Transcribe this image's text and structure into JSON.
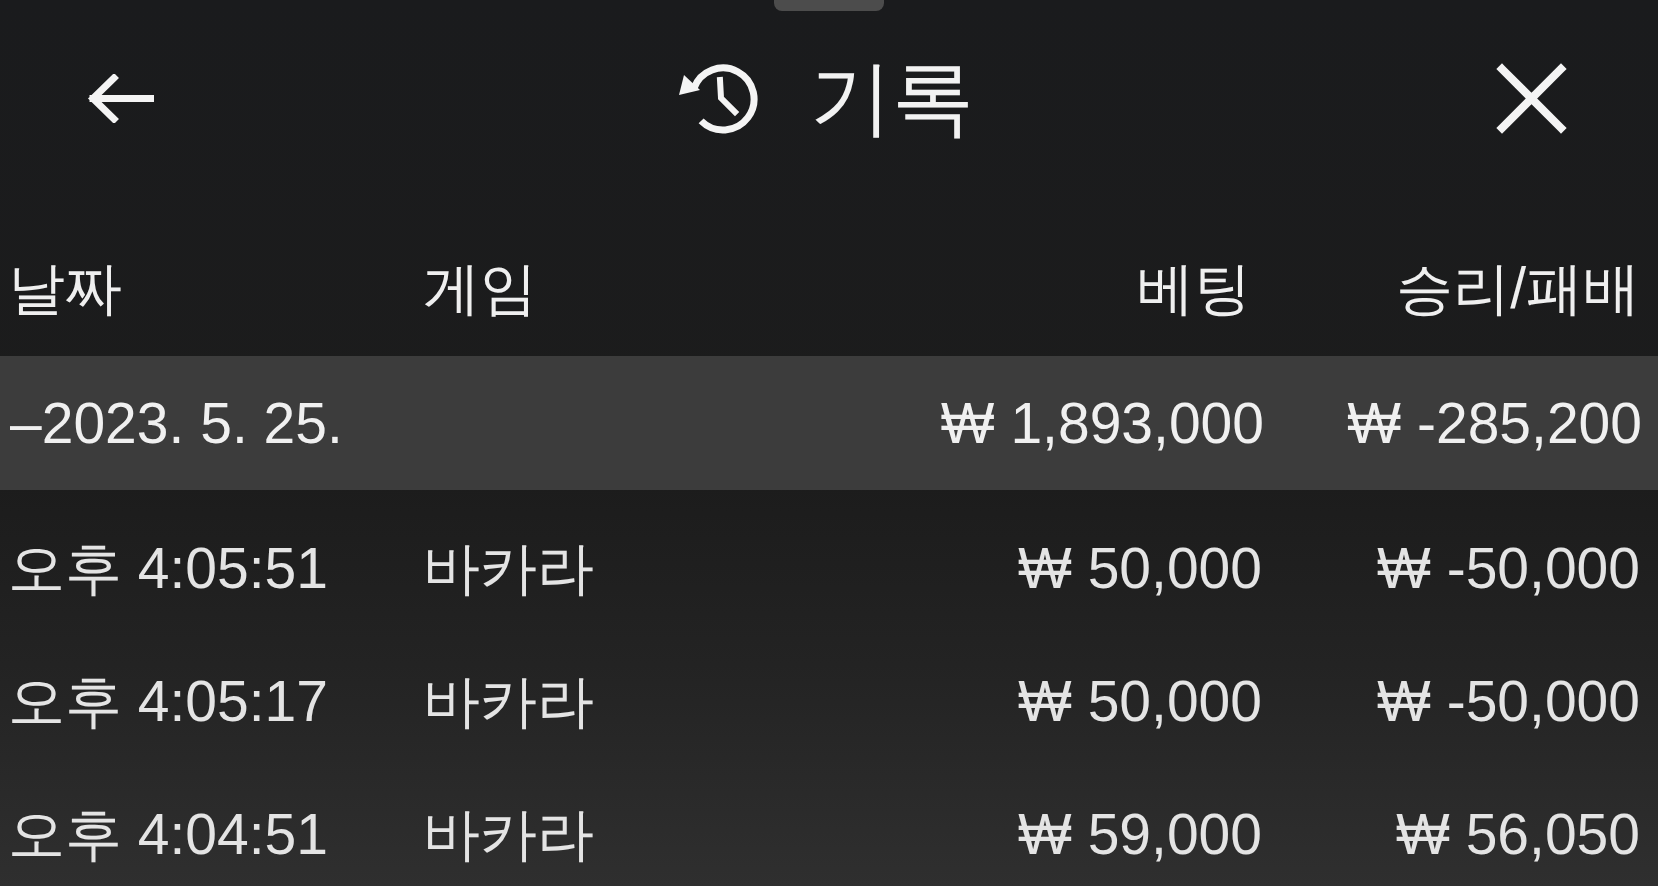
{
  "header": {
    "title": "기록"
  },
  "table": {
    "columns": [
      "날짜",
      "게임",
      "베팅",
      "승리/패배"
    ],
    "groups": [
      {
        "label": "–2023. 5. 25.",
        "bet": "₩ 1,893,000",
        "result": "₩ -285,200",
        "rows": [
          {
            "time": "오후 4:05:51",
            "game": "바카라",
            "bet": "₩ 50,000",
            "result": "₩ -50,000"
          },
          {
            "time": "오후 4:05:17",
            "game": "바카라",
            "bet": "₩ 50,000",
            "result": "₩ -50,000"
          },
          {
            "time": "오후 4:04:51",
            "game": "바카라",
            "bet": "₩ 59,000",
            "result": "₩ 56,050"
          }
        ]
      }
    ]
  }
}
